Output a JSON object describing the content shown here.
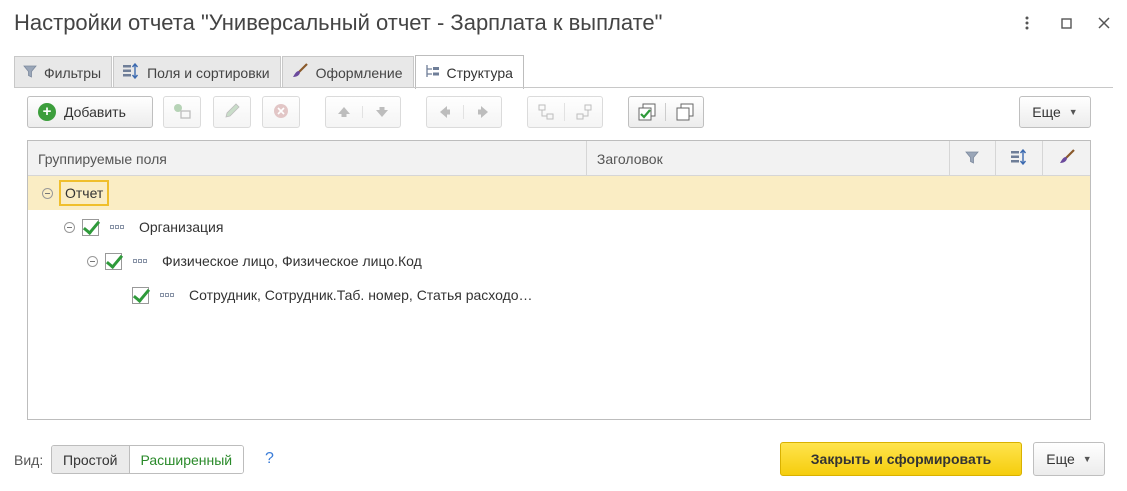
{
  "window": {
    "title": "Настройки отчета \"Универсальный отчет - Зарплата к выплате\""
  },
  "tabs": [
    {
      "label": "Фильтры",
      "icon": "filter-icon"
    },
    {
      "label": "Поля и сортировки",
      "icon": "fields-sort-icon"
    },
    {
      "label": "Оформление",
      "icon": "brush-icon"
    },
    {
      "label": "Структура",
      "icon": "structure-icon",
      "active": true
    }
  ],
  "toolbar": {
    "add_label": "Добавить",
    "more_label": "Еще"
  },
  "table": {
    "columns": [
      "Группируемые поля",
      "Заголовок"
    ],
    "rows": [
      {
        "label": "Отчет",
        "level": 0
      },
      {
        "label": "Организация",
        "level": 1
      },
      {
        "label": "Физическое лицо, Физическое лицо.Код",
        "level": 2
      },
      {
        "label": "Сотрудник, Сотрудник.Таб. номер, Статья расходо…",
        "level": 3
      }
    ]
  },
  "footer": {
    "view_label": "Вид:",
    "view_options": [
      "Простой",
      "Расширенный"
    ],
    "help": "?",
    "primary_label": "Закрыть и сформировать",
    "more_label": "Еще"
  },
  "colors": {
    "primary": "#f5cd0d",
    "selected_row": "#faedc4",
    "check": "#2e9a3a",
    "add_icon": "#3c9e3c"
  }
}
